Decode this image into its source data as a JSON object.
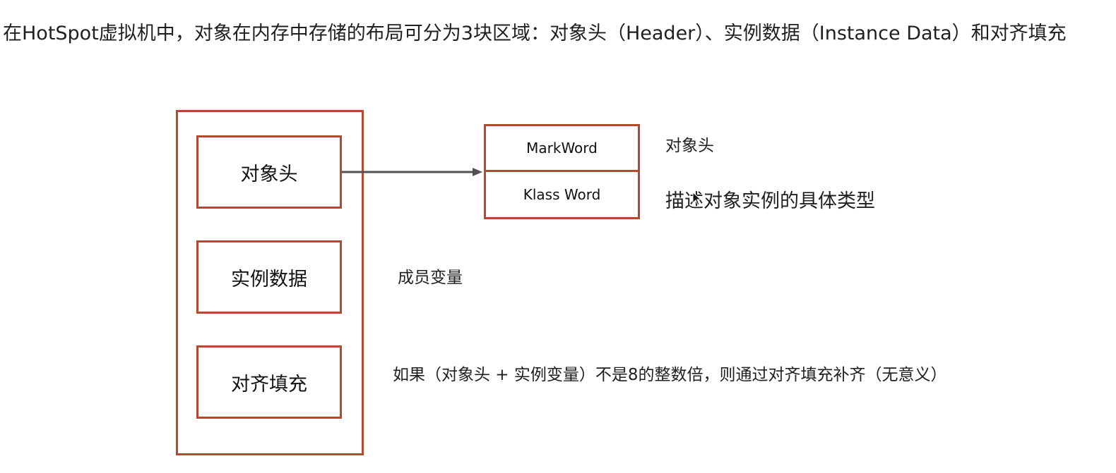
{
  "intro_text": "在HotSpot虚拟机中，对象在内存中存储的布局可分为3块区域：对象头（Header）、实例数据（Instance Data）和对齐填充",
  "object_layout": {
    "sections": [
      {
        "label": "对象头"
      },
      {
        "label": "实例数据"
      },
      {
        "label": "对齐填充"
      }
    ]
  },
  "header_structure": {
    "cells": [
      {
        "label": "MarkWord"
      },
      {
        "label": "Klass Word"
      }
    ]
  },
  "annotations": {
    "header": "对象头",
    "klass_word": "描述对象实例的具体类型",
    "instance_data": "成员变量",
    "padding": "如果（对象头 + 实例变量）不是8的整数倍，则通过对齐填充补齐（无意义）"
  },
  "colors": {
    "box_border": "#b5482e",
    "arrow": "#505050"
  }
}
